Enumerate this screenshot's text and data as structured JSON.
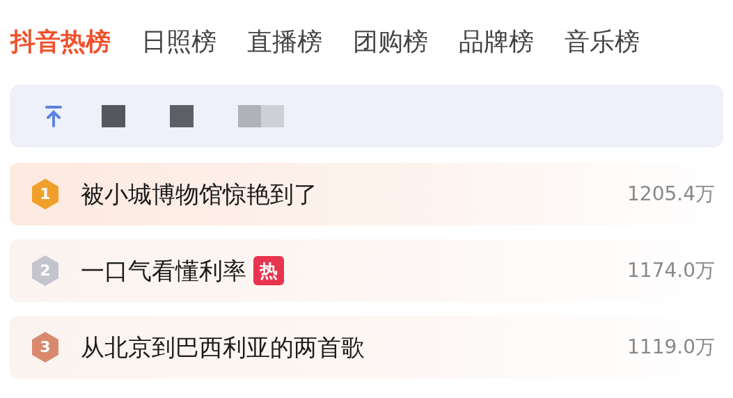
{
  "tabs": [
    {
      "label": "抖音热榜",
      "selected": true
    },
    {
      "label": "日照榜",
      "selected": false
    },
    {
      "label": "直播榜",
      "selected": false
    },
    {
      "label": "团购榜",
      "selected": false
    },
    {
      "label": "品牌榜",
      "selected": false
    },
    {
      "label": "音乐榜",
      "selected": false
    }
  ],
  "pinned": {
    "kind": "redacted"
  },
  "items": [
    {
      "rank": "1",
      "color": "#f0a02a",
      "title": "被小城博物馆惊艳到了",
      "heat": "1205.4万"
    },
    {
      "rank": "2",
      "color": "#c4c4cc",
      "title": "一口气看懂利率",
      "tag": "热",
      "heat": "1174.0万"
    },
    {
      "rank": "3",
      "color": "#d98a6e",
      "title": "从北京到巴西利亚的两首歌",
      "heat": "1119.0万"
    }
  ]
}
